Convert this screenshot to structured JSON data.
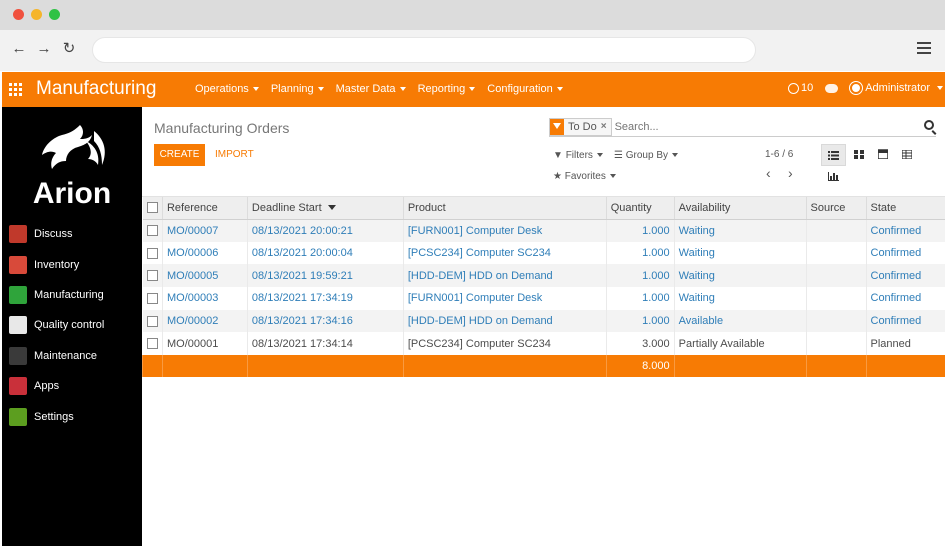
{
  "app": {
    "brand": "Manufacturing",
    "menu": [
      "Operations",
      "Planning",
      "Master Data",
      "Reporting",
      "Configuration"
    ],
    "activity_count": "10",
    "user": "Administrator"
  },
  "sidebar": {
    "logo_text": "Arion",
    "items": [
      {
        "label": "Discuss",
        "color": "#c0392b"
      },
      {
        "label": "Inventory",
        "color": "#d84a3a"
      },
      {
        "label": "Manufacturing",
        "color": "#2fa43b"
      },
      {
        "label": "Quality control",
        "color": "#e8e8e8"
      },
      {
        "label": "Maintenance",
        "color": "#3a3a3a"
      },
      {
        "label": "Apps",
        "color": "#c9303a"
      },
      {
        "label": "Settings",
        "color": "#5c9e1f"
      }
    ]
  },
  "control_panel": {
    "breadcrumb": "Manufacturing Orders",
    "create_label": "CREATE",
    "import_label": "IMPORT",
    "facet_label": "To Do",
    "search_placeholder": "Search...",
    "filters_label": "Filters",
    "groupby_label": "Group By",
    "favorites_label": "Favorites",
    "pager": "1-6 / 6"
  },
  "table": {
    "columns": [
      "Reference",
      "Deadline Start",
      "Product",
      "Quantity",
      "Availability",
      "Source",
      "State"
    ],
    "rows": [
      {
        "ref": "MO/00007",
        "deadline": "08/13/2021 20:00:21",
        "product": "[FURN001] Computer Desk",
        "qty": "1.000",
        "availability": "Waiting",
        "source": "",
        "state": "Confirmed",
        "highlight": true
      },
      {
        "ref": "MO/00006",
        "deadline": "08/13/2021 20:00:04",
        "product": "[PCSC234] Computer SC234",
        "qty": "1.000",
        "availability": "Waiting",
        "source": "",
        "state": "Confirmed",
        "highlight": true
      },
      {
        "ref": "MO/00005",
        "deadline": "08/13/2021 19:59:21",
        "product": "[HDD-DEM] HDD on Demand",
        "qty": "1.000",
        "availability": "Waiting",
        "source": "",
        "state": "Confirmed",
        "highlight": true
      },
      {
        "ref": "MO/00003",
        "deadline": "08/13/2021 17:34:19",
        "product": "[FURN001] Computer Desk",
        "qty": "1.000",
        "availability": "Waiting",
        "source": "",
        "state": "Confirmed",
        "highlight": true
      },
      {
        "ref": "MO/00002",
        "deadline": "08/13/2021 17:34:16",
        "product": "[HDD-DEM] HDD on Demand",
        "qty": "1.000",
        "availability": "Available",
        "source": "",
        "state": "Confirmed",
        "highlight": true
      },
      {
        "ref": "MO/00001",
        "deadline": "08/13/2021 17:34:14",
        "product": "[PCSC234] Computer SC234",
        "qty": "3.000",
        "availability": "Partially Available",
        "source": "",
        "state": "Planned",
        "highlight": false
      }
    ],
    "total_qty": "8.000"
  },
  "colors": {
    "accent": "#f77b04",
    "link": "#2f7eb8"
  }
}
